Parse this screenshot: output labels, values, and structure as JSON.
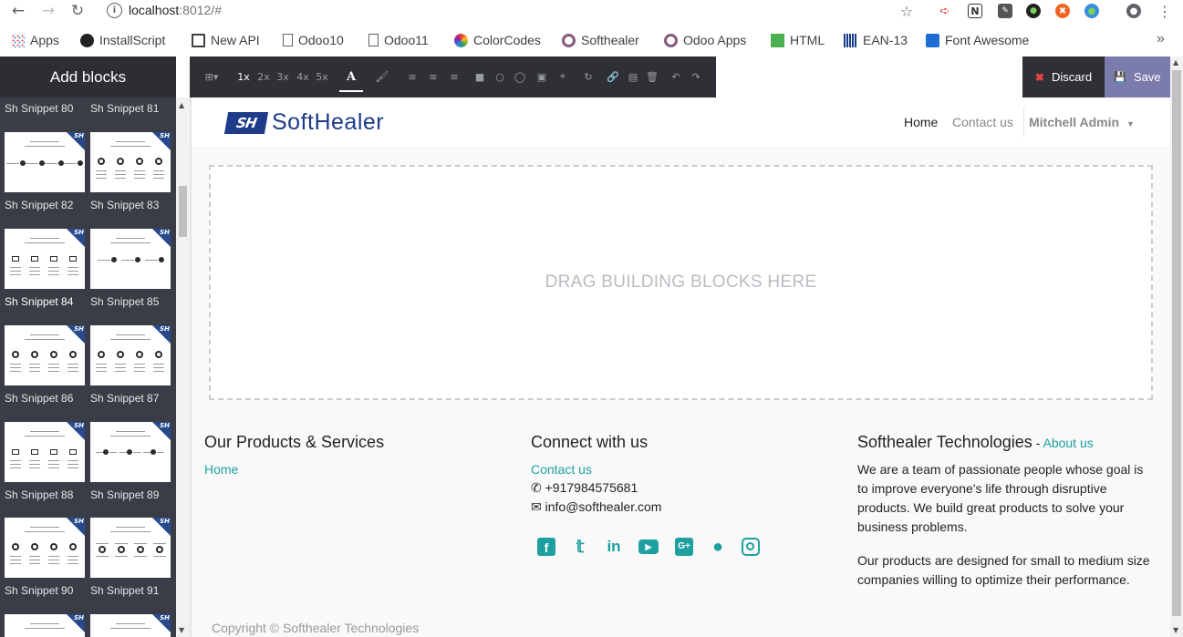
{
  "browser": {
    "url_host": "localhost",
    "url_rest": ":8012/#",
    "bookmarks": [
      "Apps",
      "InstallScript",
      "New API",
      "Odoo10",
      "Odoo11",
      "ColorCodes",
      "Softhealer",
      "Odoo Apps",
      "HTML",
      "EAN-13",
      "Font Awesome"
    ],
    "more": "»",
    "icons": [
      "back-arrow-icon",
      "forward-arrow-icon",
      "reload-icon",
      "info-icon",
      "star-icon",
      "account-icon",
      "menu-dots-icon"
    ]
  },
  "sidebar": {
    "title": "Add blocks",
    "snippets": [
      "Sh Snippet 80",
      "Sh Snippet 81",
      "Sh Snippet 82",
      "Sh Snippet 83",
      "Sh Snippet 84",
      "Sh Snippet 85",
      "Sh Snippet 86",
      "Sh Snippet 87",
      "Sh Snippet 88",
      "Sh Snippet 89",
      "Sh Snippet 90",
      "Sh Snippet 91"
    ],
    "hovered": "Sh Snippet 84"
  },
  "toolbar": {
    "zoom_levels": [
      "1x",
      "2x",
      "3x",
      "4x",
      "5x"
    ],
    "active_zoom": "1x",
    "font_glyph": "A",
    "discard_label": "Discard",
    "save_label": "Save"
  },
  "site": {
    "logo_mark": "SH",
    "logo_text": "SoftHealer",
    "menu": {
      "home": "Home",
      "contact": "Contact us",
      "user": "Mitchell Admin"
    },
    "dropzone_text": "DRAG BUILDING BLOCKS HERE",
    "footer": {
      "col1_title": "Our Products & Services",
      "col1_link": "Home",
      "col2_title": "Connect with us",
      "col2_link": "Contact us",
      "phone": "+917984575681",
      "email": "info@softhealer.com",
      "col3_title": "Softhealer Technologies",
      "col3_sep": " - ",
      "col3_link": "About us",
      "para1_lines": [
        "We are a team of passionate people whose goal is",
        "to improve everyone's life through disruptive",
        "products. We build great products to solve your",
        "business problems."
      ],
      "para2_lines": [
        "Our products are designed for small to medium size",
        "companies willing to optimize their performance."
      ],
      "copyright": "Copyright © Softhealer Technologies"
    },
    "social_icons": [
      "facebook-icon",
      "twitter-icon",
      "linkedin-icon",
      "youtube-icon",
      "google-plus-icon",
      "github-icon",
      "instagram-icon"
    ],
    "accent_color": "#1fa0a0",
    "brand_color": "#1e3b8a"
  }
}
